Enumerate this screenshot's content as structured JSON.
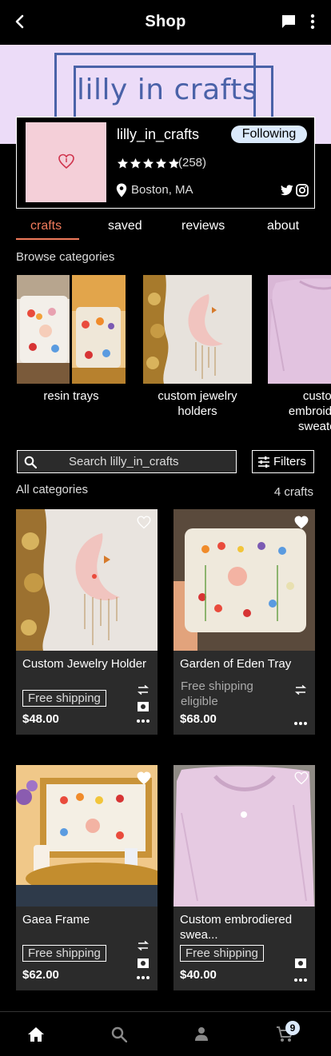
{
  "header": {
    "title": "Shop"
  },
  "banner": {
    "logo_text": "lilly in crafts",
    "bg_color": "#ecdcf8",
    "logo_color": "#4a62a8"
  },
  "shop": {
    "name": "lilly_in_crafts",
    "follow_label": "Following",
    "rating_stars": 5,
    "rating_count": "(258)",
    "location": "Boston, MA"
  },
  "tabs": [
    {
      "label": "crafts",
      "active": true
    },
    {
      "label": "saved",
      "active": false
    },
    {
      "label": "reviews",
      "active": false
    },
    {
      "label": "about",
      "active": false
    }
  ],
  "browse": {
    "label": "Browse categories",
    "categories": [
      {
        "label": "resin trays"
      },
      {
        "label": "custom jewelry holders"
      },
      {
        "label": "custom embroidered sweaters"
      }
    ]
  },
  "search": {
    "placeholder": "Search lilly_in_crafts",
    "filters_label": "Filters"
  },
  "listing": {
    "all_categories_label": "All categories",
    "count_label": "4 crafts"
  },
  "products": [
    {
      "name": "Custom Jewelry Holder",
      "shipping": "Free shipping",
      "price": "$48.00",
      "favorited": false
    },
    {
      "name": "Garden of Eden Tray",
      "shipping": "Free shipping eligible",
      "price": "$68.00",
      "favorited": true
    },
    {
      "name": "Gaea Frame",
      "shipping": "Free shipping",
      "price": "$62.00",
      "favorited": true
    },
    {
      "name": "Custom embrodiered swea...",
      "shipping": "Free shipping",
      "price": "$40.00",
      "favorited": false
    }
  ],
  "bottom_nav": {
    "items": [
      {
        "icon": "home-icon"
      },
      {
        "icon": "search-icon"
      },
      {
        "icon": "profile-icon"
      },
      {
        "icon": "cart-icon"
      }
    ],
    "cart_count": "9"
  },
  "colors": {
    "accent": "#f07b5c",
    "card_bg": "#2b2b2b",
    "badge_bg": "#dbe9fb"
  }
}
